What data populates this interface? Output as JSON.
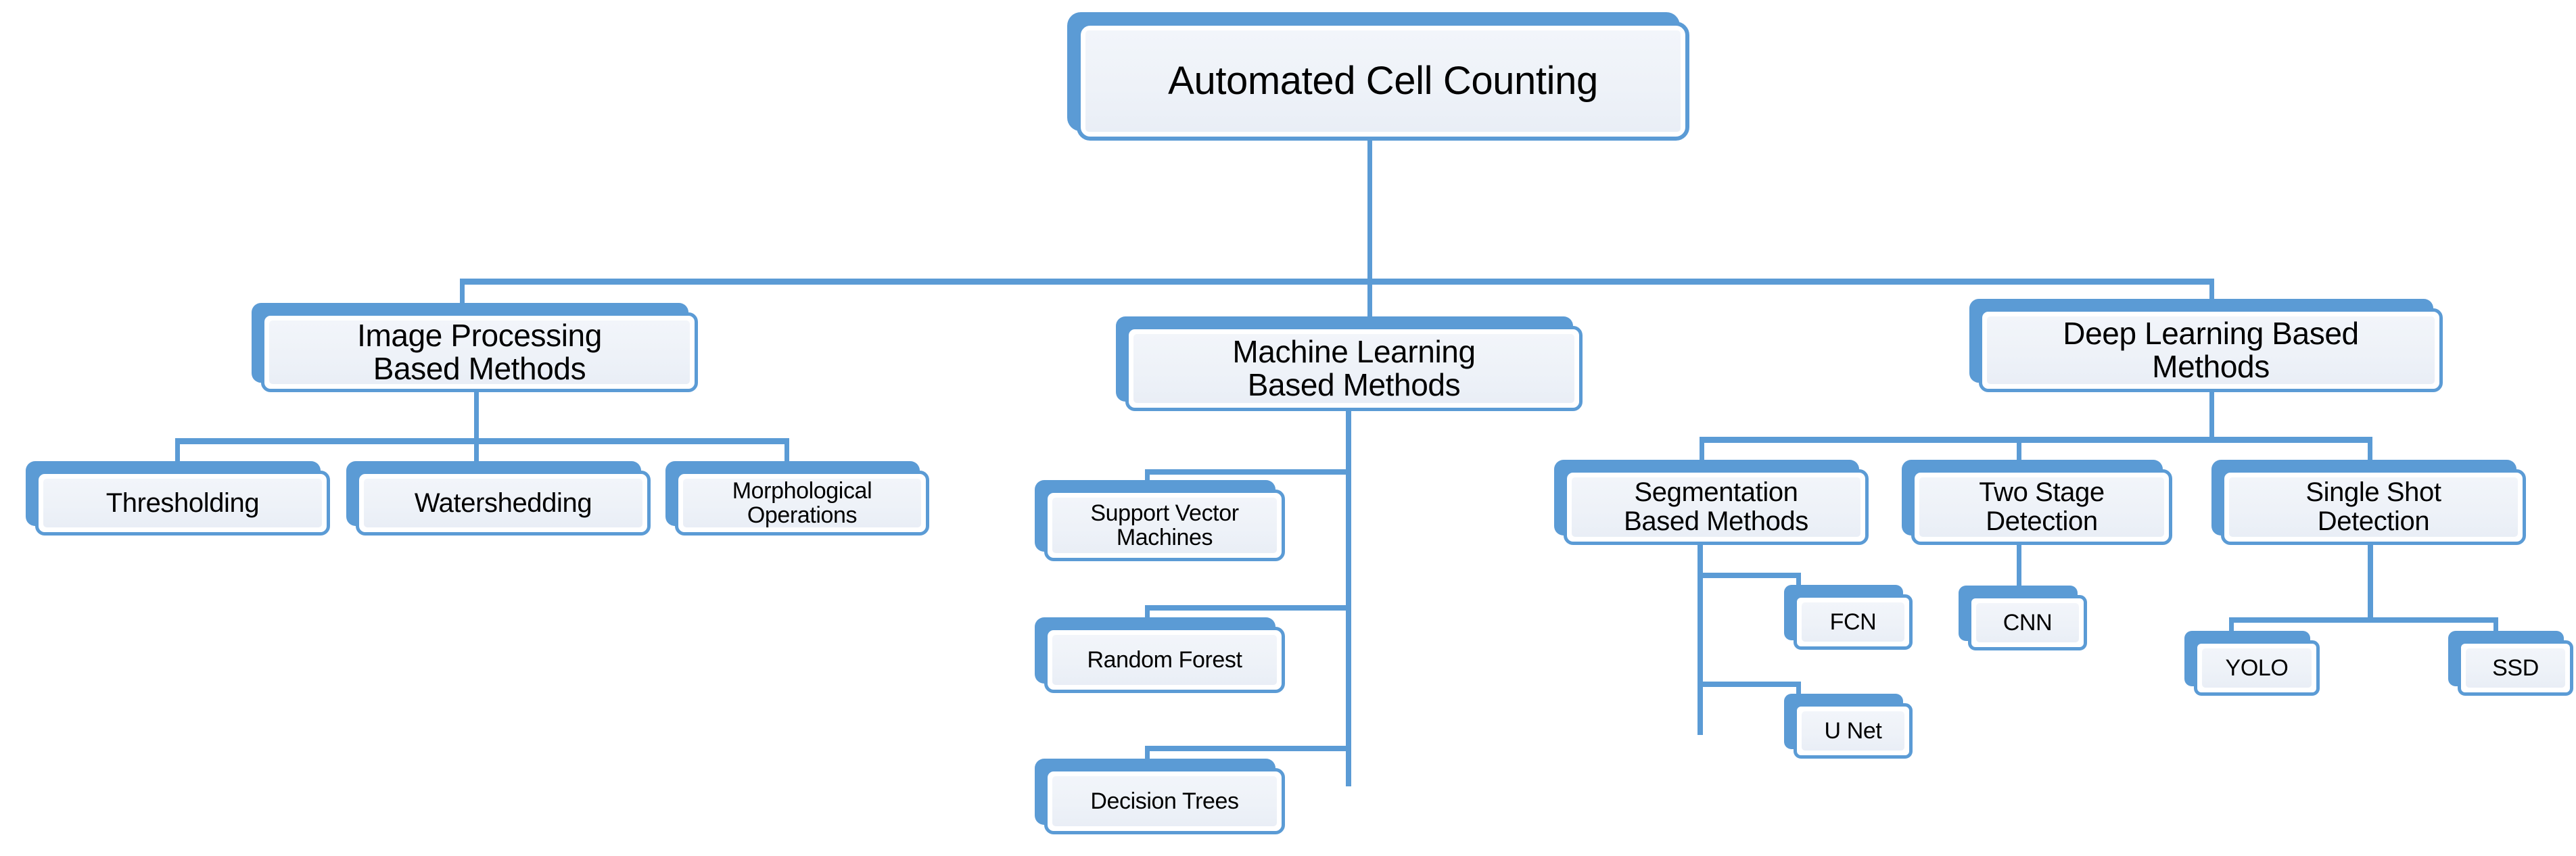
{
  "diagram": {
    "title": "Automated Cell Counting",
    "type": "hierarchy-tree",
    "colors": {
      "accent": "#5B9BD5",
      "node_fill": "#EEF2F8",
      "node_inner_border": "#FFFFFF",
      "text": "#000000",
      "background": "#FFFFFF"
    },
    "root": {
      "label": "Automated Cell Counting"
    },
    "level2": [
      {
        "id": "image-processing-based-methods",
        "label": "Image Processing\nBased Methods"
      },
      {
        "id": "machine-learning-based-methods",
        "label": "Machine Learning\nBased Methods"
      },
      {
        "id": "deep-learning-based-methods",
        "label": "Deep Learning Based\nMethods"
      }
    ],
    "image_processing_children": [
      {
        "id": "thresholding",
        "label": "Thresholding"
      },
      {
        "id": "watershedding",
        "label": "Watershedding"
      },
      {
        "id": "morphological-operations",
        "label": "Morphological\nOperations"
      }
    ],
    "machine_learning_children": [
      {
        "id": "support-vector-machines",
        "label": "Support Vector\nMachines"
      },
      {
        "id": "random-forest",
        "label": "Random Forest"
      },
      {
        "id": "decision-trees",
        "label": "Decision Trees"
      }
    ],
    "deep_learning_children": [
      {
        "id": "segmentation-based-methods",
        "label": "Segmentation\nBased Methods"
      },
      {
        "id": "two-stage-detection",
        "label": "Two Stage\nDetection"
      },
      {
        "id": "single-shot-detection",
        "label": "Single Shot\nDetection"
      }
    ],
    "segmentation_children": [
      {
        "id": "fcn",
        "label": "FCN"
      },
      {
        "id": "u-net",
        "label": "U Net"
      }
    ],
    "two_stage_children": [
      {
        "id": "cnn",
        "label": "CNN"
      }
    ],
    "single_shot_children": [
      {
        "id": "yolo",
        "label": "YOLO"
      },
      {
        "id": "ssd",
        "label": "SSD"
      }
    ]
  }
}
